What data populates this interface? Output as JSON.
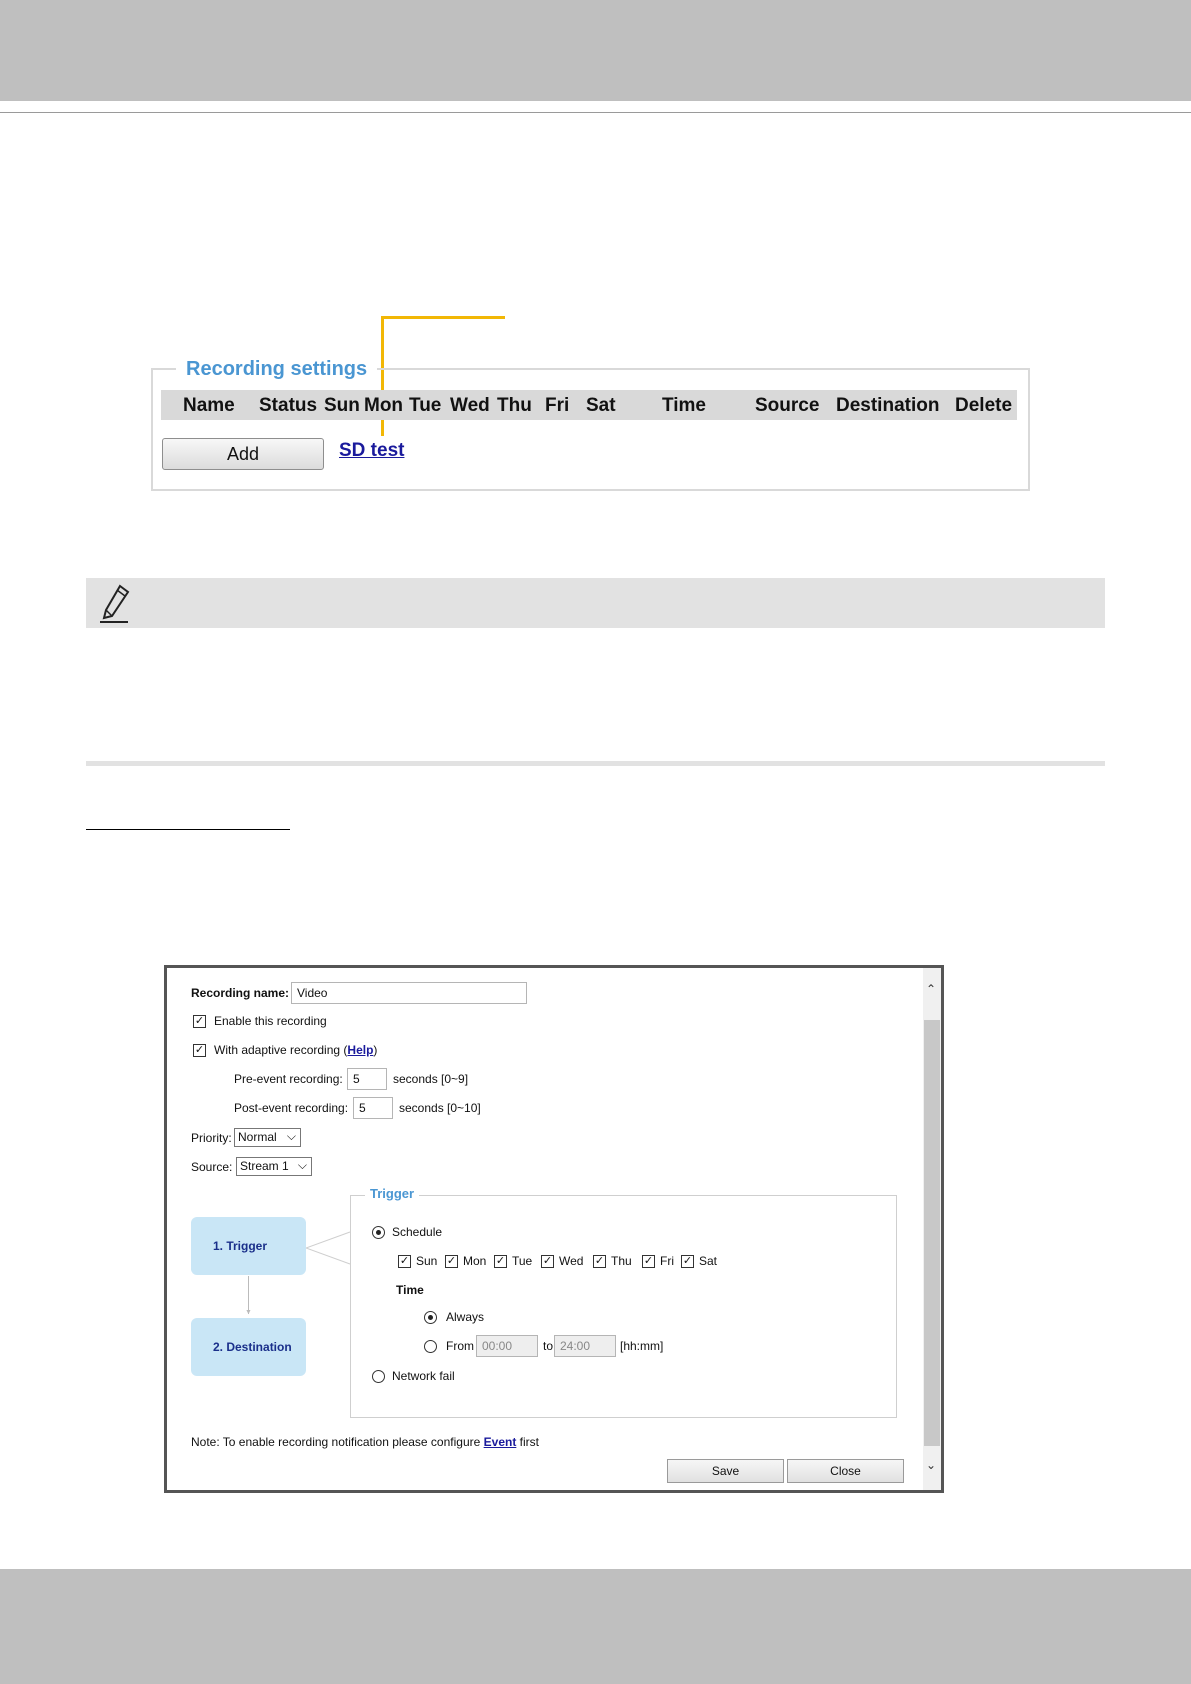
{
  "recording_settings": {
    "legend": "Recording settings",
    "columns": [
      "Name",
      "Status",
      "Sun",
      "Mon",
      "Tue",
      "Wed",
      "Thu",
      "Fri",
      "Sat",
      "Time",
      "Source",
      "Destination",
      "Delete"
    ],
    "add_label": "Add",
    "entry_link": "SD test"
  },
  "dialog": {
    "recording_name_label": "Recording name:",
    "recording_name_value": "Video",
    "enable_label": "Enable this recording",
    "adaptive_prefix": "With adaptive recording (",
    "adaptive_help": "Help",
    "adaptive_suffix": ")",
    "pre_event_label": "Pre-event recording:",
    "pre_event_value": "5",
    "pre_event_unit": "seconds [0~9]",
    "post_event_label": "Post-event recording:",
    "post_event_value": "5",
    "post_event_unit": "seconds [0~10]",
    "priority_label": "Priority:",
    "priority_value": "Normal",
    "source_label": "Source:",
    "source_value": "Stream 1",
    "steps": [
      "1.  Trigger",
      "2.  Destination"
    ],
    "trigger": {
      "legend": "Trigger",
      "schedule_label": "Schedule",
      "days": [
        "Sun",
        "Mon",
        "Tue",
        "Wed",
        "Thu",
        "Fri",
        "Sat"
      ],
      "time_heading": "Time",
      "always_label": "Always",
      "from_label": "From",
      "from_value": "00:00",
      "to_label": "to",
      "to_value": "24:00",
      "format_hint": "[hh:mm]",
      "network_fail_label": "Network fail"
    },
    "note_prefix": "Note: To enable recording notification please configure ",
    "note_link": "Event",
    "note_suffix": " first",
    "save_label": "Save",
    "close_label": "Close"
  }
}
